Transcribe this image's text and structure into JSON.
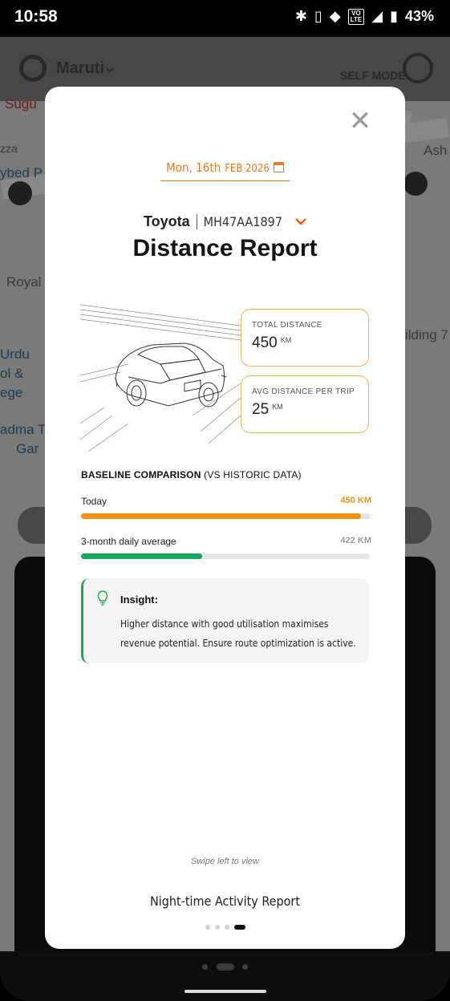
{
  "status_bar": {
    "time": "10:58",
    "battery": "43%"
  },
  "background_app": {
    "brand": "Maruti",
    "mode_label": "SELF MODE",
    "map_labels": [
      "Sugu",
      "zza",
      "ybed P",
      "Royal",
      "Urdu",
      "ol &",
      "ege",
      "adma T",
      "Gar",
      "ilding 7",
      "Ash"
    ]
  },
  "modal": {
    "date": {
      "day": "Mon, 16th",
      "rest": "FEB 2026",
      "icon": "calendar-icon"
    },
    "vehicle": {
      "make": "Toyota",
      "registration": "MH47AA1897",
      "dropdown_icon": "chevron-down-icon"
    },
    "title": "Distance Report",
    "stats": [
      {
        "label": "TOTAL DISTANCE",
        "value": "450",
        "unit": "KM"
      },
      {
        "label": "AVG DISTANCE PER TRIP",
        "value": "25",
        "unit": "KM"
      }
    ],
    "baseline": {
      "heading_bold": "BASELINE COMPARISON",
      "heading_rest": "(VS HISTORIC DATA)",
      "rows": [
        {
          "label": "Today",
          "value": "450 KM",
          "fill": 0.97,
          "color": "#f5900e",
          "value_color": "#f5900e"
        },
        {
          "label": "3-month daily average",
          "value": "422 KM",
          "fill": 0.42,
          "color": "#17a85b",
          "value_color": "#9a9a9a"
        }
      ]
    },
    "insight": {
      "icon": "lightbulb-icon",
      "title": "Insight:",
      "body": "Higher distance with good utilisation maximises revenue potential. Ensure route optimization is active."
    },
    "footer": {
      "hint": "Swipe left to view",
      "next_report": "Night-time Activity Report",
      "pages": 4,
      "active_page": 4
    }
  },
  "colors": {
    "accent_orange": "#e77a1e",
    "today_bar": "#f5900e",
    "average_bar": "#17a85b"
  }
}
